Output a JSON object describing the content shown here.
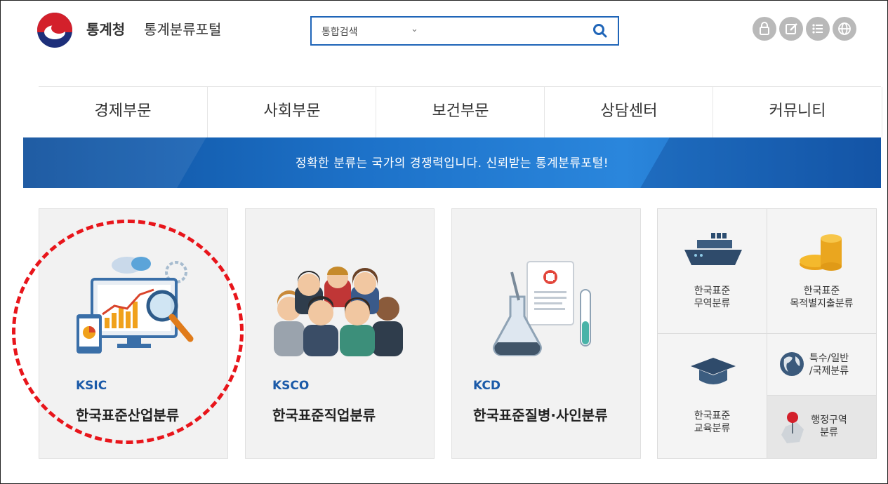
{
  "header": {
    "brand": "통계청",
    "portal_name": "통계분류포털",
    "search_select": "통합검색"
  },
  "nav": [
    "경제부문",
    "사회부문",
    "보건부문",
    "상담센터",
    "커뮤니티"
  ],
  "banner": "정확한 분류는 국가의 경쟁력입니다. 신뢰받는 통계분류포털!",
  "cards": [
    {
      "code": "KSIC",
      "name": "한국표준산업분류"
    },
    {
      "code": "KSCO",
      "name": "한국표준직업분류"
    },
    {
      "code": "KCD",
      "name": "한국표준질병·사인분류"
    }
  ],
  "side_tiles": {
    "trade": "한국표준\n무역분류",
    "expenditure": "한국표준\n목적별지출분류",
    "education": "한국표준\n교육분류",
    "special": "특수/일반\n/국제분류",
    "admin": "행정구역\n분류"
  },
  "colors": {
    "accent": "#1b5aa8",
    "banner": "#1d72c9",
    "highlight": "#e8151b"
  }
}
